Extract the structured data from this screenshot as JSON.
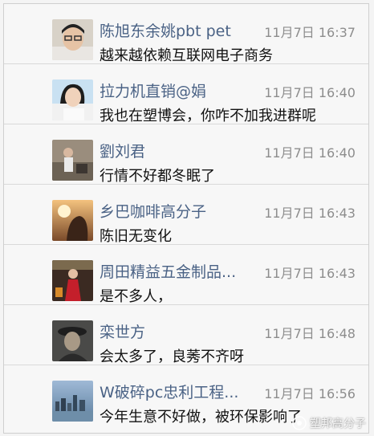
{
  "messages": [
    {
      "name": "陈旭东余姚pbt pet",
      "time": "11月7日 16:37",
      "text": "越来越依赖互联网电子商务",
      "avatar_icon": "man-glasses-avatar"
    },
    {
      "name": "拉力机直销@娟",
      "time": "11月7日 16:40",
      "text": "我也在塑博会，你咋不加我进群呢",
      "avatar_icon": "woman-avatar"
    },
    {
      "name": "劉刘君",
      "time": "11月7日 16:40",
      "text": "行情不好都冬眠了",
      "avatar_icon": "figure-avatar"
    },
    {
      "name": "乡巴咖啡高分子",
      "time": "11月7日 16:43",
      "text": "陈旧无变化",
      "avatar_icon": "sunset-avatar"
    },
    {
      "name": "周田精益五金制品...",
      "time": "11月7日 16:43",
      "text": "是不多人，",
      "avatar_icon": "red-dress-avatar"
    },
    {
      "name": "栾世方",
      "time": "11月7日 16:48",
      "text": "会太多了，良莠不齐呀",
      "avatar_icon": "dark-hat-avatar"
    },
    {
      "name": "W破碎pc忠利工程...",
      "time": "11月7日 16:56",
      "text": "今年生意不好做，被环保影响了",
      "avatar_icon": "harbor-avatar"
    }
  ],
  "watermark": {
    "text": "塑邦高分子",
    "icon": "watermark-logo-icon"
  },
  "colors": {
    "name": "#4a6285",
    "time": "#8d8d8d",
    "text": "#111111",
    "background": "#f7f7f7"
  }
}
